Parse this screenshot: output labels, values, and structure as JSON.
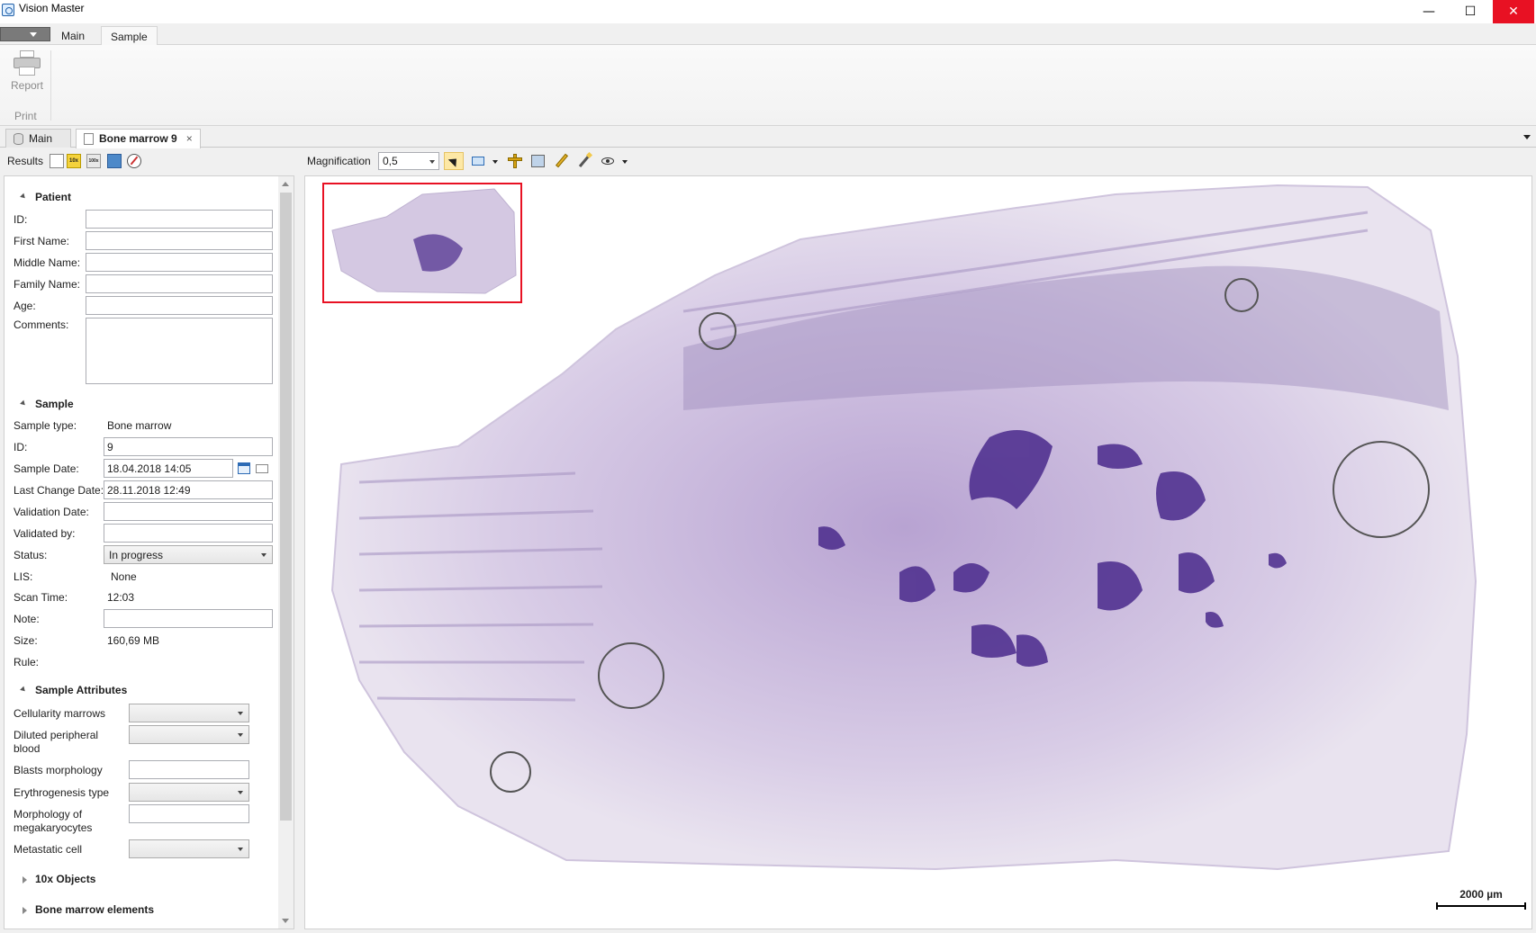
{
  "window": {
    "title": "Vision Master",
    "minimize": "—",
    "maximize": "☐",
    "close": "✕"
  },
  "ribbon": {
    "tabs": [
      {
        "label": "Main"
      },
      {
        "label": "Sample"
      }
    ],
    "active_tab": "Sample",
    "report_label": "Report",
    "group_label": "Print"
  },
  "doc_tabs": [
    {
      "label": "Main",
      "icon": "database-icon"
    },
    {
      "label": "Bone marrow 9",
      "icon": "document-icon",
      "close": "×"
    }
  ],
  "toolbar": {
    "results_label": "Results",
    "mag10_label": "10x",
    "mag100_label": "100x",
    "magnification_label": "Magnification",
    "magnification_value": "0,5"
  },
  "patient": {
    "section": "Patient",
    "labels": {
      "id": "ID:",
      "first_name": "First Name:",
      "middle_name": "Middle Name:",
      "family_name": "Family Name:",
      "age": "Age:",
      "comments": "Comments:"
    },
    "values": {
      "id": "",
      "first_name": "",
      "middle_name": "",
      "family_name": "",
      "age": "",
      "comments": ""
    }
  },
  "sample": {
    "section": "Sample",
    "labels": {
      "sample_type": "Sample type:",
      "id": "ID:",
      "sample_date": "Sample Date:",
      "last_change_date": "Last Change Date:",
      "validation_date": "Validation Date:",
      "validated_by": "Validated by:",
      "status": "Status:",
      "lis": "LIS:",
      "scan_time": "Scan Time:",
      "note": "Note:",
      "size": "Size:",
      "rule": "Rule:"
    },
    "values": {
      "sample_type": "Bone marrow",
      "id": "9",
      "sample_date": "18.04.2018 14:05",
      "last_change_date": "28.11.2018 12:49",
      "validation_date": "",
      "validated_by": "",
      "status": "In progress",
      "lis": "None",
      "scan_time": "12:03",
      "note": "",
      "size": "160,69 MB",
      "rule": ""
    }
  },
  "attributes": {
    "section": "Sample Attributes",
    "labels": {
      "cellularity": "Cellularity marrows",
      "diluted_1": "Diluted peripheral",
      "diluted_2": "blood",
      "blasts": "Blasts morphology",
      "erythro": "Erythrogenesis type",
      "morph_1": "Morphology of",
      "morph_2": "megakaryocytes",
      "metastatic": "Metastatic cell"
    }
  },
  "collapsed_sections": [
    "10x Objects",
    "Bone marrow elements"
  ],
  "viewer": {
    "scale_label": "2000 µm"
  },
  "colors": {
    "accent": "#e81123",
    "selection": "#fde8a5",
    "stain_dark": "#4a2a8c",
    "stain_light": "#c9b8dc"
  }
}
